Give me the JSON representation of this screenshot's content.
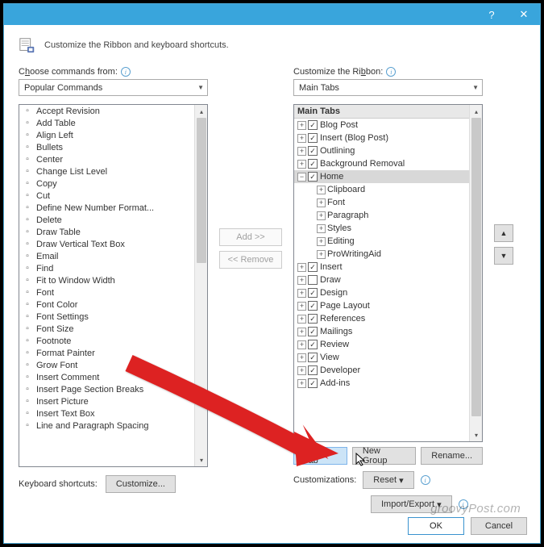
{
  "header_text": "Customize the Ribbon and keyboard shortcuts.",
  "left": {
    "label_pre": "C",
    "label_u": "h",
    "label_post": "oose commands from:",
    "combo": "Popular Commands",
    "items": [
      {
        "t": "Accept Revision",
        "sub": false
      },
      {
        "t": "Add Table",
        "sub": true
      },
      {
        "t": "Align Left",
        "sub": false
      },
      {
        "t": "Bullets",
        "sub": true,
        "split": true
      },
      {
        "t": "Center",
        "sub": false
      },
      {
        "t": "Change List Level",
        "sub": true
      },
      {
        "t": "Copy",
        "sub": false
      },
      {
        "t": "Cut",
        "sub": false
      },
      {
        "t": "Define New Number Format...",
        "sub": false
      },
      {
        "t": "Delete",
        "sub": false
      },
      {
        "t": "Draw Table",
        "sub": false
      },
      {
        "t": "Draw Vertical Text Box",
        "sub": false
      },
      {
        "t": "Email",
        "sub": false
      },
      {
        "t": "Find",
        "sub": false
      },
      {
        "t": "Fit to Window Width",
        "sub": false
      },
      {
        "t": "Font",
        "sub": false,
        "split": true
      },
      {
        "t": "Font Color",
        "sub": true,
        "split": true
      },
      {
        "t": "Font Settings",
        "sub": false
      },
      {
        "t": "Font Size",
        "sub": false,
        "split": true
      },
      {
        "t": "Footnote",
        "sub": false
      },
      {
        "t": "Format Painter",
        "sub": false
      },
      {
        "t": "Grow Font",
        "sub": false
      },
      {
        "t": "Insert Comment",
        "sub": false
      },
      {
        "t": "Insert Page  Section Breaks",
        "sub": true
      },
      {
        "t": "Insert Picture",
        "sub": false
      },
      {
        "t": "Insert Text Box",
        "sub": true
      },
      {
        "t": "Line and Paragraph Spacing",
        "sub": true,
        "split": true
      }
    ]
  },
  "right": {
    "label": "Customize the Ri",
    "label_u": "b",
    "label_post": "bon:",
    "combo": "Main Tabs",
    "header": "Main Tabs",
    "nodes": [
      {
        "indent": 0,
        "exp": "+",
        "chk": true,
        "t": "Blog Post"
      },
      {
        "indent": 0,
        "exp": "+",
        "chk": true,
        "t": "Insert (Blog Post)"
      },
      {
        "indent": 0,
        "exp": "+",
        "chk": true,
        "t": "Outlining"
      },
      {
        "indent": 0,
        "exp": "+",
        "chk": true,
        "t": "Background Removal"
      },
      {
        "indent": 0,
        "exp": "-",
        "chk": true,
        "t": "Home",
        "sel": true
      },
      {
        "indent": 1,
        "exp": "+",
        "t": "Clipboard"
      },
      {
        "indent": 1,
        "exp": "+",
        "t": "Font"
      },
      {
        "indent": 1,
        "exp": "+",
        "t": "Paragraph"
      },
      {
        "indent": 1,
        "exp": "+",
        "t": "Styles"
      },
      {
        "indent": 1,
        "exp": "+",
        "t": "Editing"
      },
      {
        "indent": 1,
        "exp": "+",
        "t": "ProWritingAid"
      },
      {
        "indent": 0,
        "exp": "+",
        "chk": true,
        "t": "Insert"
      },
      {
        "indent": 0,
        "exp": "+",
        "chk": false,
        "t": "Draw"
      },
      {
        "indent": 0,
        "exp": "+",
        "chk": true,
        "t": "Design"
      },
      {
        "indent": 0,
        "exp": "+",
        "chk": true,
        "t": "Page Layout"
      },
      {
        "indent": 0,
        "exp": "+",
        "chk": true,
        "t": "References"
      },
      {
        "indent": 0,
        "exp": "+",
        "chk": true,
        "t": "Mailings"
      },
      {
        "indent": 0,
        "exp": "+",
        "chk": true,
        "t": "Review"
      },
      {
        "indent": 0,
        "exp": "+",
        "chk": true,
        "t": "View"
      },
      {
        "indent": 0,
        "exp": "+",
        "chk": true,
        "t": "Developer"
      },
      {
        "indent": 0,
        "exp": "+",
        "chk": true,
        "t": "Add-ins"
      }
    ]
  },
  "mid": {
    "add": "Add >>",
    "remove": "<< Remove"
  },
  "buttons": {
    "new_tab": "New Tab",
    "new_group": "New Group",
    "rename": "Rename...",
    "customizations": "Customizations:",
    "reset": "Reset",
    "import_export": "Import/Export",
    "kbd_label": "Keyboard shortcuts:",
    "customize": "Customize...",
    "ok": "OK",
    "cancel": "Cancel"
  },
  "watermark": "groovyPost.com"
}
